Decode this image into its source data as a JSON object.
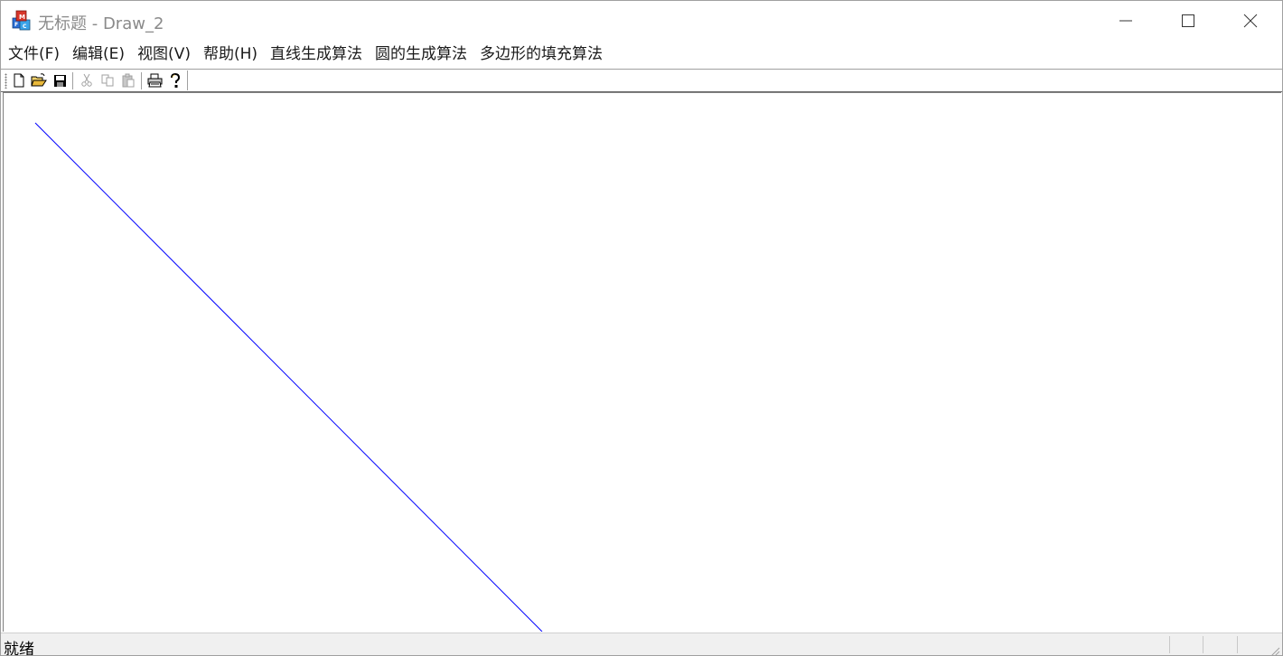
{
  "window": {
    "title": "无标题 - Draw_2",
    "icon": "mfc-app-icon",
    "controls": [
      "minimize-icon",
      "maximize-icon",
      "close-icon"
    ]
  },
  "menu": {
    "items": [
      {
        "label": "文件(F)"
      },
      {
        "label": "编辑(E)"
      },
      {
        "label": "视图(V)"
      },
      {
        "label": "帮助(H)"
      },
      {
        "label": "直线生成算法"
      },
      {
        "label": "圆的生成算法"
      },
      {
        "label": "多边形的填充算法"
      }
    ]
  },
  "toolbar": {
    "buttons": [
      {
        "icon": "new-document-icon",
        "enabled": true
      },
      {
        "icon": "open-folder-icon",
        "enabled": true
      },
      {
        "icon": "save-icon",
        "enabled": true
      },
      {
        "icon": "cut-icon",
        "enabled": false
      },
      {
        "icon": "copy-icon",
        "enabled": false
      },
      {
        "icon": "paste-icon",
        "enabled": false
      },
      {
        "icon": "print-icon",
        "enabled": true
      },
      {
        "icon": "help-icon",
        "enabled": true
      }
    ]
  },
  "canvas": {
    "line_color": "#0000ff"
  },
  "status": {
    "text": "就绪"
  },
  "colors": {
    "title_text": "#8a8a8a",
    "line": "#0000ff",
    "statusbar_bg": "#f0f0f0"
  }
}
